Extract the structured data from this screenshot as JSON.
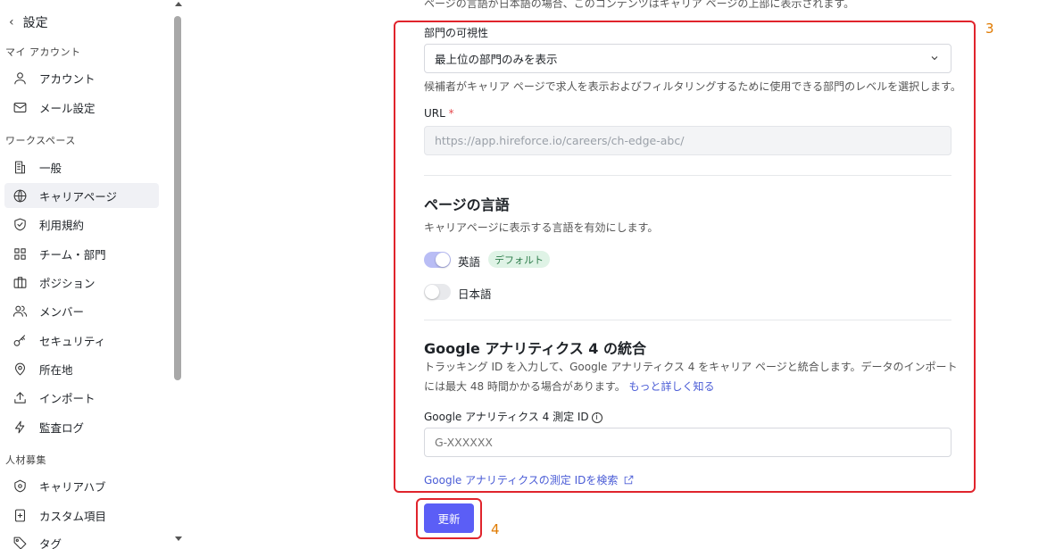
{
  "sidebar": {
    "back_label": "設定",
    "sections": {
      "account": "マイ アカウント",
      "workspace": "ワークスペース",
      "recruiting": "人材募集"
    },
    "items": [
      {
        "label": "アカウント",
        "icon": "user-icon"
      },
      {
        "label": "メール設定",
        "icon": "mail-icon"
      },
      {
        "label": "一般",
        "icon": "building-icon"
      },
      {
        "label": "キャリアページ",
        "icon": "globe-icon",
        "active": true
      },
      {
        "label": "利用規約",
        "icon": "shield-check-icon"
      },
      {
        "label": "チーム・部門",
        "icon": "grid-icon"
      },
      {
        "label": "ポジション",
        "icon": "briefcase-icon"
      },
      {
        "label": "メンバー",
        "icon": "users-icon"
      },
      {
        "label": "セキュリティ",
        "icon": "key-icon"
      },
      {
        "label": "所在地",
        "icon": "map-pin-icon"
      },
      {
        "label": "インポート",
        "icon": "upload-icon"
      },
      {
        "label": "監査ログ",
        "icon": "bolt-icon"
      },
      {
        "label": "キャリアハブ",
        "icon": "hub-icon"
      },
      {
        "label": "カスタム項目",
        "icon": "custom-field-icon"
      },
      {
        "label": "タグ",
        "icon": "tag-icon"
      }
    ]
  },
  "main": {
    "top_note": "ページの言語が日本語の場合、このコンテンツはキャリア ページの上部に表示されます。",
    "department_visibility": {
      "label": "部門の可視性",
      "selected": "最上位の部門のみを表示",
      "help": "候補者がキャリア ページで求人を表示およびフィルタリングするために使用できる部門のレベルを選択します。"
    },
    "url": {
      "label": "URL",
      "required_mark": "*",
      "value": "https://app.hireforce.io/careers/ch-edge-abc/"
    },
    "page_language": {
      "title": "ページの言語",
      "description": "キャリアページに表示する言語を有効にします。",
      "languages": [
        {
          "label": "英語",
          "enabled": true,
          "badge": "デフォルト"
        },
        {
          "label": "日本語",
          "enabled": false
        }
      ]
    },
    "ga4": {
      "title": "Google アナリティクス 4 の統合",
      "description": "トラッキング ID を入力して、Google アナリティクス 4 をキャリア ページと統合します。データのインポートには最大 48 時間かかる場合があります。",
      "learn_more": "もっと詳しく知る",
      "field_label": "Google アナリティクス 4 測定 ID",
      "info_glyph": "i",
      "placeholder": "G-XXXXXX",
      "search_link": "Google アナリティクスの測定 IDを検索"
    },
    "update_button": "更新"
  },
  "annotations": {
    "box3": "3",
    "box4": "4",
    "color": "#e0242c"
  }
}
